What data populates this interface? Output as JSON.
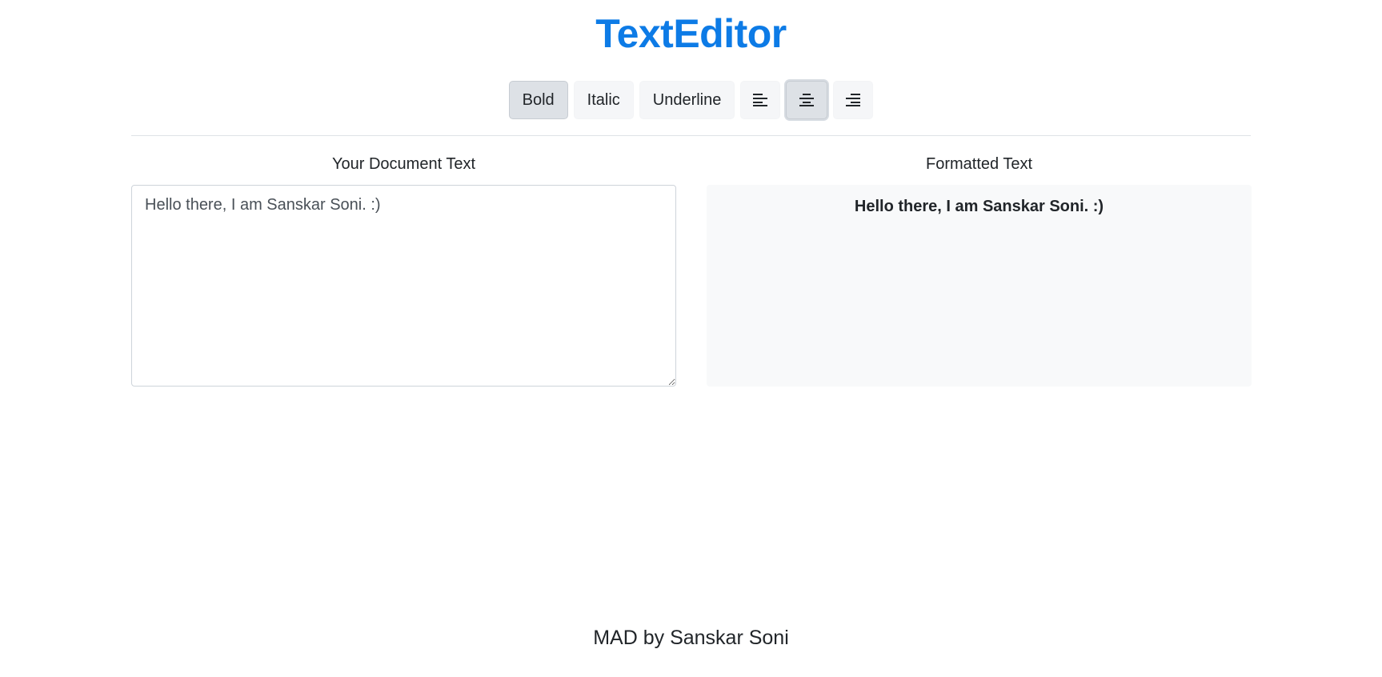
{
  "app": {
    "title": "TextEditor",
    "accent_color": "#0d7be6"
  },
  "toolbar": {
    "bold_label": "Bold",
    "italic_label": "Italic",
    "underline_label": "Underline",
    "align_left_icon": "align-left-icon",
    "align_center_icon": "align-center-icon",
    "align_right_icon": "align-right-icon",
    "active": [
      "Bold",
      "align-center"
    ]
  },
  "editor": {
    "label": "Your Document Text",
    "value": "Hello there, I am Sanskar Soni. :)"
  },
  "preview": {
    "label": "Formatted Text",
    "text": "Hello there, I am Sanskar Soni. :)",
    "style": {
      "bold": true,
      "italic": false,
      "underline": false,
      "align": "center"
    }
  },
  "footer": {
    "text": "MAD by Sanskar Soni"
  }
}
